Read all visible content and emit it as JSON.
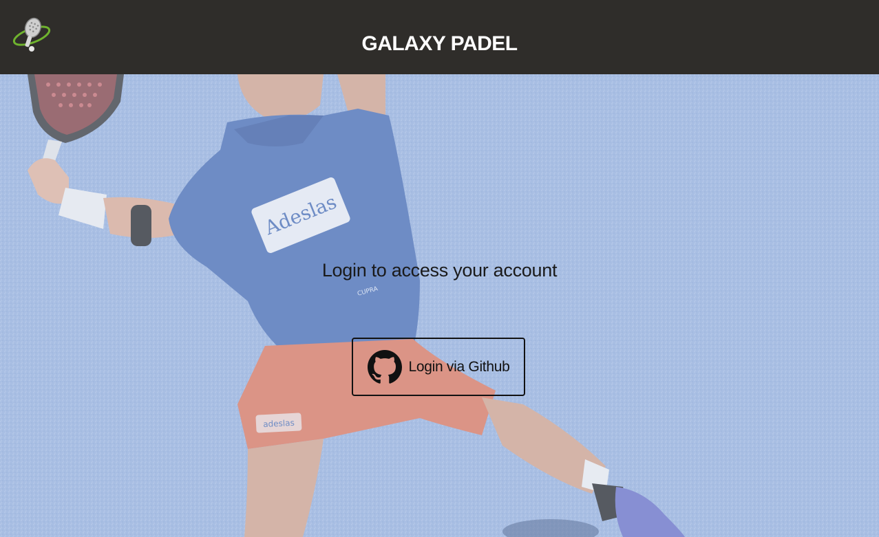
{
  "header": {
    "brand": "GALAXY PADEL",
    "logo_icon": "padel-racket-orbit-icon"
  },
  "hero": {
    "image": "padel-player-background-image",
    "shirt_sponsor": "Adeslas",
    "shirt_small_text": "CUPRA",
    "shorts_sponsor": "adeslas"
  },
  "login": {
    "prompt": "Login to access your account",
    "github_button_label": "Login via Github",
    "github_icon": "github-icon"
  },
  "colors": {
    "header_bg": "#2f2d2a",
    "court_bg": "#9db6df",
    "brand_text": "#ffffff",
    "logo_accent": "#6fb32e"
  }
}
